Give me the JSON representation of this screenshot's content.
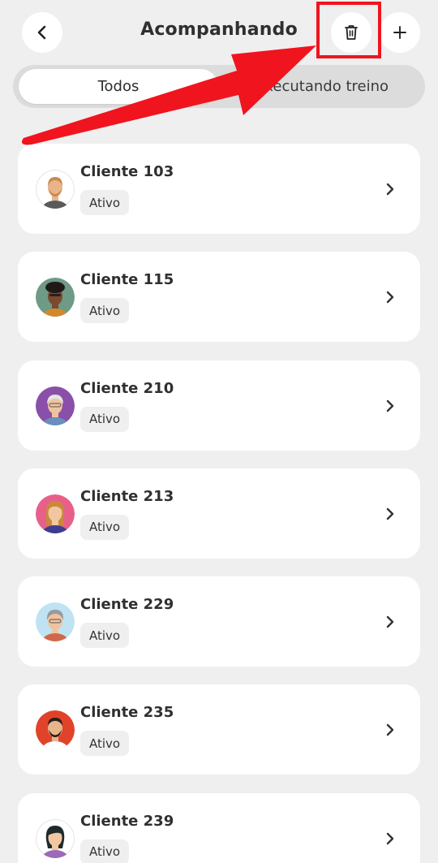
{
  "header": {
    "title": "Acompanhando",
    "back_icon": "chevron-left-icon",
    "trash_icon": "trash-icon",
    "add_icon": "plus-icon"
  },
  "tabs": [
    {
      "label": "Todos",
      "active": true
    },
    {
      "label": "Executando treino",
      "active": false
    }
  ],
  "clients": [
    {
      "name": "Cliente 103",
      "status": "Ativo",
      "avatar_bg": "#ffffff",
      "skin": "#e8b48a",
      "hair": "#c98a4a",
      "shirt": "#5a5a5a"
    },
    {
      "name": "Cliente 115",
      "status": "Ativo",
      "avatar_bg": "#6f9a86",
      "skin": "#7a4a2e",
      "hair": "#1f1a17",
      "shirt": "#d08a2a"
    },
    {
      "name": "Cliente 210",
      "status": "Ativo",
      "avatar_bg": "#8a4fa8",
      "skin": "#f0c3a0",
      "hair": "#e5e5e5",
      "shirt": "#6a8fbf"
    },
    {
      "name": "Cliente 213",
      "status": "Ativo",
      "avatar_bg": "#e8608a",
      "skin": "#f3c6a2",
      "hair": "#c88a3a",
      "shirt": "#3d3d8f"
    },
    {
      "name": "Cliente 229",
      "status": "Ativo",
      "avatar_bg": "#bfe3f3",
      "skin": "#f0c3a0",
      "hair": "#9a9a9a",
      "shirt": "#d0674a"
    },
    {
      "name": "Cliente 235",
      "status": "Ativo",
      "avatar_bg": "#e0432a",
      "skin": "#e8b48a",
      "hair": "#2a1e18",
      "shirt": "#ffffff"
    },
    {
      "name": "Cliente 239",
      "status": "Ativo",
      "avatar_bg": "#ffffff",
      "skin": "#f3c6a2",
      "hair": "#1f2a2a",
      "shirt": "#9b6ab8"
    }
  ],
  "accent_color": "#f0141e"
}
